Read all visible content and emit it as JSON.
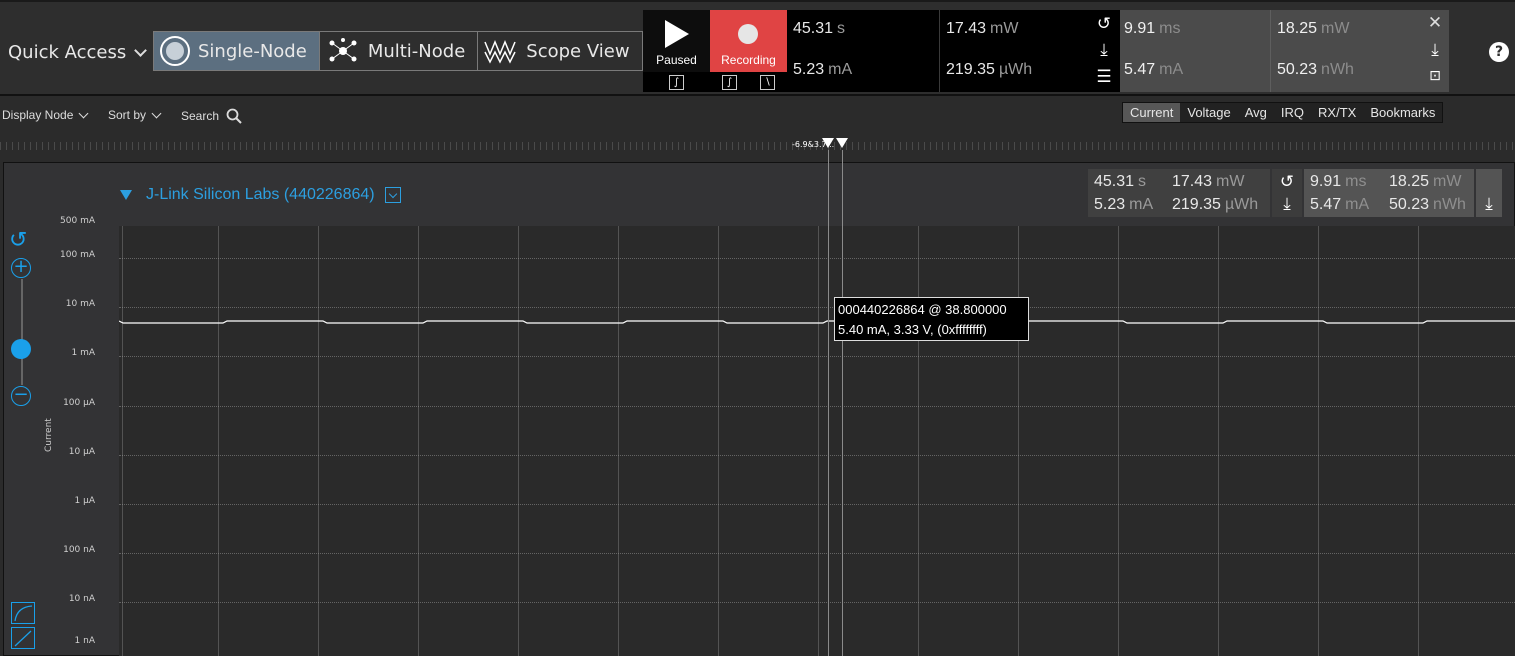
{
  "toolbar": {
    "quick_access": "Quick Access",
    "modes": [
      "Single-Node",
      "Multi-Node",
      "Scope View"
    ],
    "play_label": "Paused",
    "record_label": "Recording",
    "measure": {
      "time": "45.31",
      "time_unit": "s",
      "power": "17.43",
      "power_unit": "mW",
      "current": "5.23",
      "current_unit": "mA",
      "energy": "219.35",
      "energy_unit": "µWh"
    },
    "measure_selection": {
      "time": "9.91",
      "time_unit": "ms",
      "power": "18.25",
      "power_unit": "mW",
      "current": "5.47",
      "current_unit": "mA",
      "energy": "50.23",
      "energy_unit": "nWh"
    }
  },
  "bar2": {
    "display_node": "Display Node",
    "sort_by": "Sort by",
    "search": "Search",
    "tabs": [
      "Current",
      "Voltage",
      "Avg",
      "IRQ",
      "RX/TX",
      "Bookmarks"
    ],
    "active_tab": "Current"
  },
  "cursor_label": "-6.9&3.7...",
  "panel": {
    "node_name": "J-Link Silicon Labs (440226864)",
    "y_axis_title": "Current",
    "y_ticks": [
      "500 mA",
      "100 mA",
      "10 mA",
      "1 mA",
      "100 µA",
      "10 µA",
      "1 µA",
      "100 nA",
      "10 nA",
      "1 nA"
    ]
  },
  "tooltip": {
    "line1": "000440226864 @ 38.800000",
    "line2": "5.40 mA, 3.33 V, (0xffffffff)"
  },
  "colors": {
    "accent": "#1aa0ea",
    "record": "#e04444",
    "trace": "#ffffff"
  }
}
